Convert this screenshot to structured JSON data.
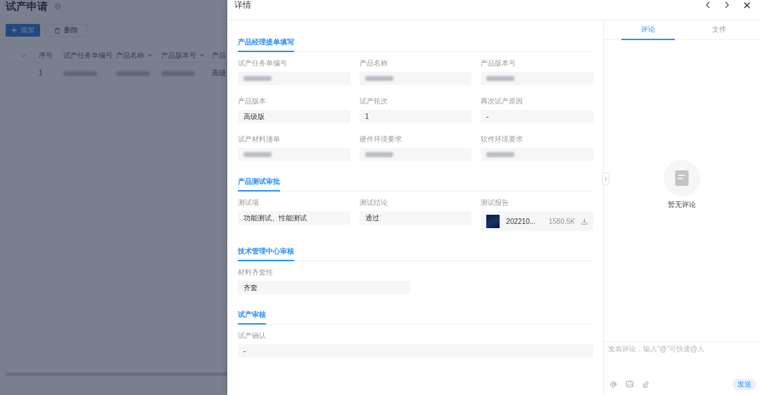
{
  "page": {
    "title": "试产申请",
    "toolbar": [
      {
        "kind": "add",
        "label": "添加"
      },
      {
        "kind": "delete",
        "label": "删除"
      }
    ],
    "table": {
      "columns": [
        {
          "label": "序号",
          "filter": false
        },
        {
          "label": "试产任务单编号",
          "filter": false
        },
        {
          "label": "产品名称",
          "filter": true
        },
        {
          "label": "产品版本号",
          "filter": true
        },
        {
          "label": "产品",
          "filter": false
        }
      ],
      "rows": [
        {
          "cells": [
            {
              "text": "1",
              "redacted": false
            },
            {
              "redacted": true
            },
            {
              "redacted": true
            },
            {
              "redacted": true
            },
            {
              "text": "高级",
              "redacted": false
            }
          ]
        }
      ]
    }
  },
  "drawer": {
    "title": "详情",
    "sections": [
      {
        "title": "产品经理提单填写",
        "fields": [
          {
            "kind": "text",
            "label": "试产任务单编号",
            "redacted": true
          },
          {
            "kind": "text",
            "label": "产品名称",
            "redacted": true
          },
          {
            "kind": "text",
            "label": "产品版本号",
            "redacted": true
          },
          {
            "kind": "text",
            "label": "产品版本",
            "value": "高级版",
            "redacted": false
          },
          {
            "kind": "text",
            "label": "试产轮次",
            "value": "1",
            "redacted": false
          },
          {
            "kind": "text",
            "label": "再次试产原因",
            "value": "-",
            "redacted": false
          },
          {
            "kind": "text",
            "label": "试产材料清单",
            "redacted": true
          },
          {
            "kind": "text",
            "label": "硬件环境要求",
            "redacted": true
          },
          {
            "kind": "text",
            "label": "软件环境要求",
            "redacted": true
          }
        ]
      },
      {
        "title": "产品测试审批",
        "fields": [
          {
            "kind": "text",
            "label": "测试项",
            "value": "功能测试、性能测试",
            "redacted": false
          },
          {
            "kind": "text",
            "label": "测试结论",
            "value": "通过",
            "redacted": false
          },
          {
            "kind": "file",
            "label": "测试报告",
            "file_name": "202210...",
            "file_size": "1580.5K"
          }
        ]
      },
      {
        "title": "技术管理中心审核",
        "fields": [
          {
            "kind": "text",
            "label": "材料齐套性",
            "value": "齐套",
            "redacted": false
          }
        ]
      },
      {
        "title": "试产审核",
        "fields": [
          {
            "kind": "text",
            "label": "试产确认",
            "value": "-",
            "redacted": false
          }
        ]
      }
    ]
  },
  "comments_panel": {
    "tabs": [
      {
        "label": "评论",
        "selected": true
      },
      {
        "label": "文件",
        "selected": false
      }
    ],
    "empty_text": "暂无评论",
    "comment_input": {
      "placeholder": "发表评论，输入“@”可快速@人"
    },
    "send_button": "发送"
  }
}
